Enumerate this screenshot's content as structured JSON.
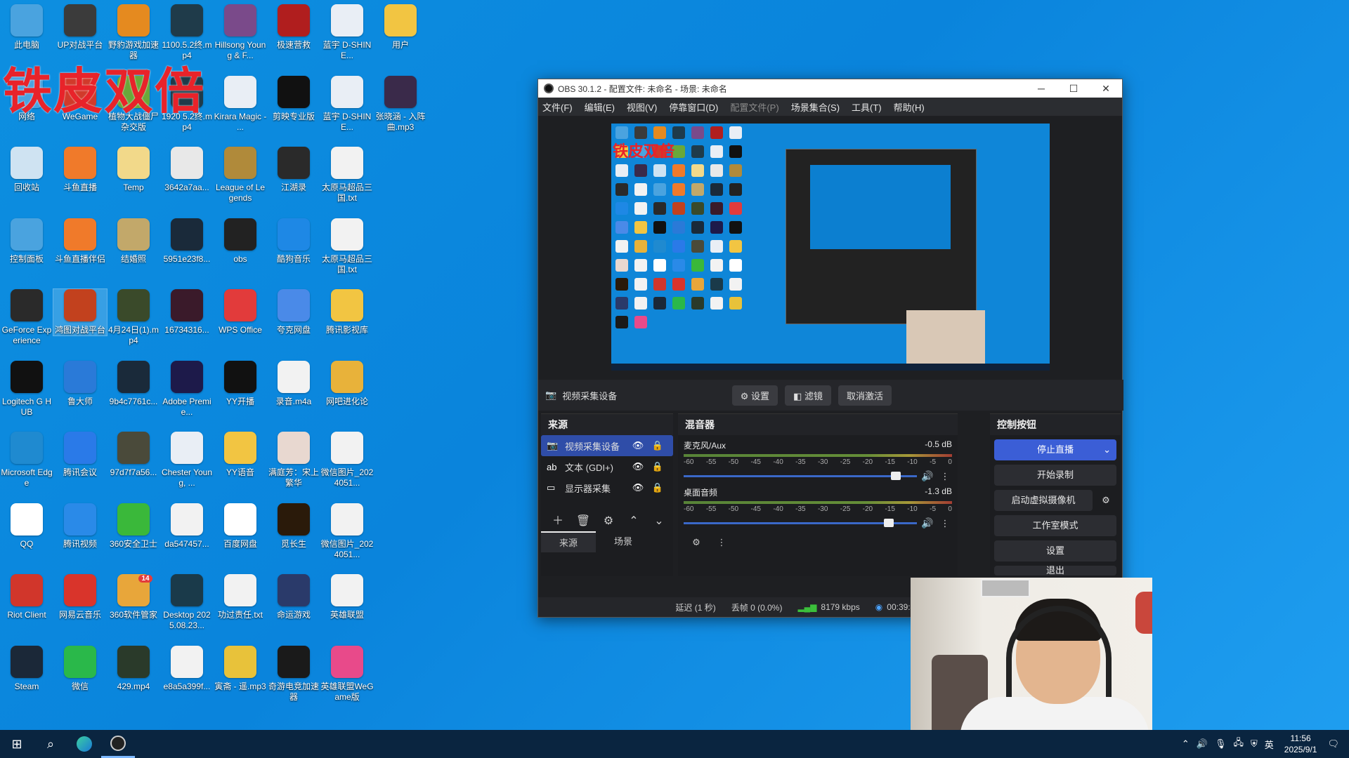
{
  "overlay": {
    "text": "铁皮双倍"
  },
  "desktop_icons": [
    {
      "label": "此电脑",
      "icon": "computer-icon",
      "color": "#4aa3df",
      "col": 0,
      "row": 0
    },
    {
      "label": "UP对战平台",
      "icon": "up-app-icon",
      "color": "#3b3b3b",
      "col": 1,
      "row": 0
    },
    {
      "label": "野豹游戏加速器",
      "icon": "leopard-icon",
      "color": "#e58a1f",
      "col": 2,
      "row": 0
    },
    {
      "label": "1100.5.2终.mp4",
      "icon": "video-file-icon",
      "color": "#1f3b4a",
      "col": 3,
      "row": 0
    },
    {
      "label": "Hillsong Young & F...",
      "icon": "album-icon",
      "color": "#7a4a8a",
      "col": 4,
      "row": 0
    },
    {
      "label": "极速营救",
      "icon": "game-icon",
      "color": "#b01e1e",
      "col": 5,
      "row": 0
    },
    {
      "label": "蓝宇 D-SHINE...",
      "icon": "mp3-file-icon",
      "color": "#e9eef5",
      "col": 6,
      "row": 0
    },
    {
      "label": "用户",
      "icon": "folder-icon",
      "color": "#f2c542",
      "col": 7,
      "row": 0
    },
    {
      "label": "网络",
      "icon": "network-icon",
      "color": "#4aa3df",
      "col": 0,
      "row": 1
    },
    {
      "label": "WeGame",
      "icon": "wegame-icon",
      "color": "#d13a2b",
      "col": 1,
      "row": 1
    },
    {
      "label": "植物大战僵尸杂交版",
      "icon": "pvz-icon",
      "color": "#6aa83a",
      "col": 2,
      "row": 1
    },
    {
      "label": "1920 5.2终.mp4",
      "icon": "video-file-icon",
      "color": "#1f3b4a",
      "col": 3,
      "row": 1
    },
    {
      "label": "Kirara Magic - ...",
      "icon": "mp3-file-icon",
      "color": "#e9eef5",
      "col": 4,
      "row": 1
    },
    {
      "label": "剪映专业版",
      "icon": "capcut-icon",
      "color": "#111111",
      "col": 5,
      "row": 1
    },
    {
      "label": "蓝宇 D-SHINE...",
      "icon": "kgm-file-icon",
      "color": "#e9eef5",
      "col": 6,
      "row": 1
    },
    {
      "label": "张晓涵 - 入阵曲.mp3",
      "icon": "album-icon",
      "color": "#3a2a4a",
      "col": 7,
      "row": 1
    },
    {
      "label": "回收站",
      "icon": "recycle-bin-icon",
      "color": "#cfe3f2",
      "col": 0,
      "row": 2
    },
    {
      "label": "斗鱼直播",
      "icon": "douyu-icon",
      "color": "#f07a2a",
      "col": 1,
      "row": 2
    },
    {
      "label": "Temp",
      "icon": "folder-icon",
      "color": "#f2d98a",
      "col": 2,
      "row": 2
    },
    {
      "label": "3642a7aa...",
      "icon": "image-file-icon",
      "color": "#e8e8e8",
      "col": 3,
      "row": 2
    },
    {
      "label": "League of Legends",
      "icon": "lol-icon",
      "color": "#b08a3a",
      "col": 4,
      "row": 2
    },
    {
      "label": "江湖录",
      "icon": "game-icon",
      "color": "#2a2a2a",
      "col": 5,
      "row": 2
    },
    {
      "label": "太原马超品三国.txt",
      "icon": "text-file-icon",
      "color": "#f2f2f2",
      "col": 6,
      "row": 2
    },
    {
      "label": "控制面板",
      "icon": "control-panel-icon",
      "color": "#4aa3df",
      "col": 0,
      "row": 3
    },
    {
      "label": "斗鱼直播伴侣",
      "icon": "douyu-icon",
      "color": "#f07a2a",
      "col": 1,
      "row": 3
    },
    {
      "label": "结婚照",
      "icon": "folder-icon",
      "color": "#c2a86a",
      "col": 2,
      "row": 3
    },
    {
      "label": "5951e23f8...",
      "icon": "image-file-icon",
      "color": "#1a2a3a",
      "col": 3,
      "row": 3
    },
    {
      "label": "obs",
      "icon": "obs-icon",
      "color": "#222222",
      "col": 4,
      "row": 3
    },
    {
      "label": "酷狗音乐",
      "icon": "kugou-icon",
      "color": "#1e88e5",
      "col": 5,
      "row": 3
    },
    {
      "label": "太原马超品三国.txt",
      "icon": "text-file-icon",
      "color": "#f2f2f2",
      "col": 6,
      "row": 3
    },
    {
      "label": "GeForce Experience",
      "icon": "nvidia-icon",
      "color": "#2a2a2a",
      "col": 0,
      "row": 4
    },
    {
      "label": "鸿图对战平台",
      "icon": "hongtu-icon",
      "color": "#c2411e",
      "col": 1,
      "row": 4,
      "selected": true
    },
    {
      "label": "4月24日(1).mp4",
      "icon": "video-file-icon",
      "color": "#3a4a2a",
      "col": 2,
      "row": 4
    },
    {
      "label": "16734316...",
      "icon": "video-file-icon",
      "color": "#3a1a2a",
      "col": 3,
      "row": 4
    },
    {
      "label": "WPS Office",
      "icon": "wps-icon",
      "color": "#e23b3b",
      "col": 4,
      "row": 4
    },
    {
      "label": "夸克网盘",
      "icon": "cloud-icon",
      "color": "#4a8ae8",
      "col": 5,
      "row": 4
    },
    {
      "label": "腾讯影视库",
      "icon": "folder-icon",
      "color": "#f2c542",
      "col": 6,
      "row": 4
    },
    {
      "label": "Logitech G HUB",
      "icon": "logitech-icon",
      "color": "#111111",
      "col": 0,
      "row": 5
    },
    {
      "label": "鲁大师",
      "icon": "ludashi-icon",
      "color": "#2a7ad8",
      "col": 1,
      "row": 5
    },
    {
      "label": "9b4c7761c...",
      "icon": "video-file-icon",
      "color": "#1a2a3a",
      "col": 2,
      "row": 5
    },
    {
      "label": "Adobe Premie...",
      "icon": "premiere-icon",
      "color": "#1d1a4a",
      "col": 3,
      "row": 5
    },
    {
      "label": "YY开播",
      "icon": "yy-icon",
      "color": "#111111",
      "col": 4,
      "row": 5
    },
    {
      "label": "录音.m4a",
      "icon": "audio-file-icon",
      "color": "#f2f2f2",
      "col": 5,
      "row": 5
    },
    {
      "label": "网吧进化论",
      "icon": "book-icon",
      "color": "#e8b23a",
      "col": 6,
      "row": 5
    },
    {
      "label": "Microsoft Edge",
      "icon": "edge-icon",
      "color": "#1f8ad0",
      "col": 0,
      "row": 6
    },
    {
      "label": "腾讯会议",
      "icon": "tencent-meeting-icon",
      "color": "#2a7ae8",
      "col": 1,
      "row": 6
    },
    {
      "label": "97d7f7a56...",
      "icon": "image-file-icon",
      "color": "#4a4a3a",
      "col": 2,
      "row": 6
    },
    {
      "label": "Chester Young, ...",
      "icon": "flac-file-icon",
      "color": "#e9eef5",
      "col": 3,
      "row": 6
    },
    {
      "label": "YY语音",
      "icon": "yy-voice-icon",
      "color": "#f2c542",
      "col": 4,
      "row": 6
    },
    {
      "label": "满庭芳：宋上繁华",
      "icon": "game-icon",
      "color": "#e8d8d0",
      "col": 5,
      "row": 6
    },
    {
      "label": "微信图片_2024051...",
      "icon": "image-file-icon",
      "color": "#f2f2f2",
      "col": 6,
      "row": 6
    },
    {
      "label": "QQ",
      "icon": "qq-icon",
      "color": "#ffffff",
      "col": 0,
      "row": 7
    },
    {
      "label": "腾讯视频",
      "icon": "tencent-video-icon",
      "color": "#2a8ae8",
      "col": 1,
      "row": 7
    },
    {
      "label": "360安全卫士",
      "icon": "360-icon",
      "color": "#3ab83a",
      "col": 2,
      "row": 7
    },
    {
      "label": "da547457...",
      "icon": "image-file-icon",
      "color": "#f2f2f2",
      "col": 3,
      "row": 7
    },
    {
      "label": "百度网盘",
      "icon": "baidu-pan-icon",
      "color": "#ffffff",
      "col": 4,
      "row": 7
    },
    {
      "label": "觅长生",
      "icon": "game-icon",
      "color": "#2a1a0a",
      "col": 5,
      "row": 7
    },
    {
      "label": "微信图片_2024051...",
      "icon": "image-file-icon",
      "color": "#f2f2f2",
      "col": 6,
      "row": 7
    },
    {
      "label": "Riot Client",
      "icon": "riot-icon",
      "color": "#d1362b",
      "col": 0,
      "row": 8
    },
    {
      "label": "网易云音乐",
      "icon": "netease-music-icon",
      "color": "#d9342b",
      "col": 1,
      "row": 8
    },
    {
      "label": "360软件管家",
      "icon": "360-store-icon",
      "color": "#e8a63a",
      "col": 2,
      "row": 8,
      "badge": "14"
    },
    {
      "label": "Desktop 2025.08.23...",
      "icon": "video-file-icon",
      "color": "#1a3a4a",
      "col": 3,
      "row": 8
    },
    {
      "label": "功过责任.txt",
      "icon": "text-file-icon",
      "color": "#f2f2f2",
      "col": 4,
      "row": 8
    },
    {
      "label": "命运游戏",
      "icon": "game-icon",
      "color": "#2a3a6a",
      "col": 5,
      "row": 8
    },
    {
      "label": "英雄联盟",
      "icon": "text-file-icon",
      "color": "#f2f2f2",
      "col": 6,
      "row": 8
    },
    {
      "label": "Steam",
      "icon": "steam-icon",
      "color": "#1b2838",
      "col": 0,
      "row": 9
    },
    {
      "label": "微信",
      "icon": "wechat-icon",
      "color": "#2ab84a",
      "col": 1,
      "row": 9
    },
    {
      "label": "429.mp4",
      "icon": "video-file-icon",
      "color": "#2a3a2a",
      "col": 2,
      "row": 9
    },
    {
      "label": "e8a5a399f...",
      "icon": "image-file-icon",
      "color": "#f2f2f2",
      "col": 3,
      "row": 9
    },
    {
      "label": "寅斋 - 遥.mp3",
      "icon": "album-icon",
      "color": "#e8c23a",
      "col": 4,
      "row": 9
    },
    {
      "label": "奇游电竞加速器",
      "icon": "qiyou-icon",
      "color": "#1a1a1a",
      "col": 5,
      "row": 9
    },
    {
      "label": "英雄联盟WeGame版",
      "icon": "lol-wegame-icon",
      "color": "#e84a8a",
      "col": 6,
      "row": 9
    }
  ],
  "obs": {
    "title": "OBS 30.1.2 - 配置文件: 未命名 - 场景: 未命名",
    "window_controls": {
      "minimize": "─",
      "maximize": "☐",
      "close": "✕"
    },
    "menu": [
      {
        "label": "文件(F)"
      },
      {
        "label": "编辑(E)"
      },
      {
        "label": "视图(V)"
      },
      {
        "label": "停靠窗口(D)"
      },
      {
        "label": "配置文件(P)",
        "dim": true
      },
      {
        "label": "场景集合(S)"
      },
      {
        "label": "工具(T)"
      },
      {
        "label": "帮助(H)"
      }
    ],
    "context_bar": {
      "source": "视频采集设备",
      "settings": "设置",
      "filters": "滤镜",
      "deactivate": "取消激活"
    },
    "sources": {
      "title": "来源",
      "items": [
        {
          "name": "视频采集设备",
          "icon": "camera-icon",
          "active": true
        },
        {
          "name": "文本 (GDI+)",
          "icon": "text-source-icon",
          "active": false
        },
        {
          "name": "显示器采集",
          "icon": "monitor-icon",
          "active": false
        }
      ],
      "tabs": [
        "来源",
        "场景"
      ]
    },
    "mixer": {
      "title": "混音器",
      "scale": [
        "-60",
        "-55",
        "-50",
        "-45",
        "-40",
        "-35",
        "-30",
        "-25",
        "-20",
        "-15",
        "-10",
        "-5",
        "0"
      ],
      "channels": [
        {
          "name": "麦克风/Aux",
          "db": "-0.5 dB",
          "level": 0.93
        },
        {
          "name": "桌面音频",
          "db": "-1.3 dB",
          "level": 0.9
        }
      ]
    },
    "controls": {
      "title": "控制按钮",
      "stop_stream": "停止直播",
      "start_record": "开始录制",
      "virtual_cam": "启动虚拟摄像机",
      "studio_mode": "工作室模式",
      "settings": "设置",
      "exit": "退出"
    },
    "status": {
      "delay": "延迟 (1 秒)",
      "dropped": "丢帧 0 (0.0%)",
      "bitrate": "8179 kbps",
      "time": "00:39:40"
    }
  },
  "taskbar": {
    "ime": "英",
    "time": "11:56",
    "date": "2025/9/1"
  }
}
